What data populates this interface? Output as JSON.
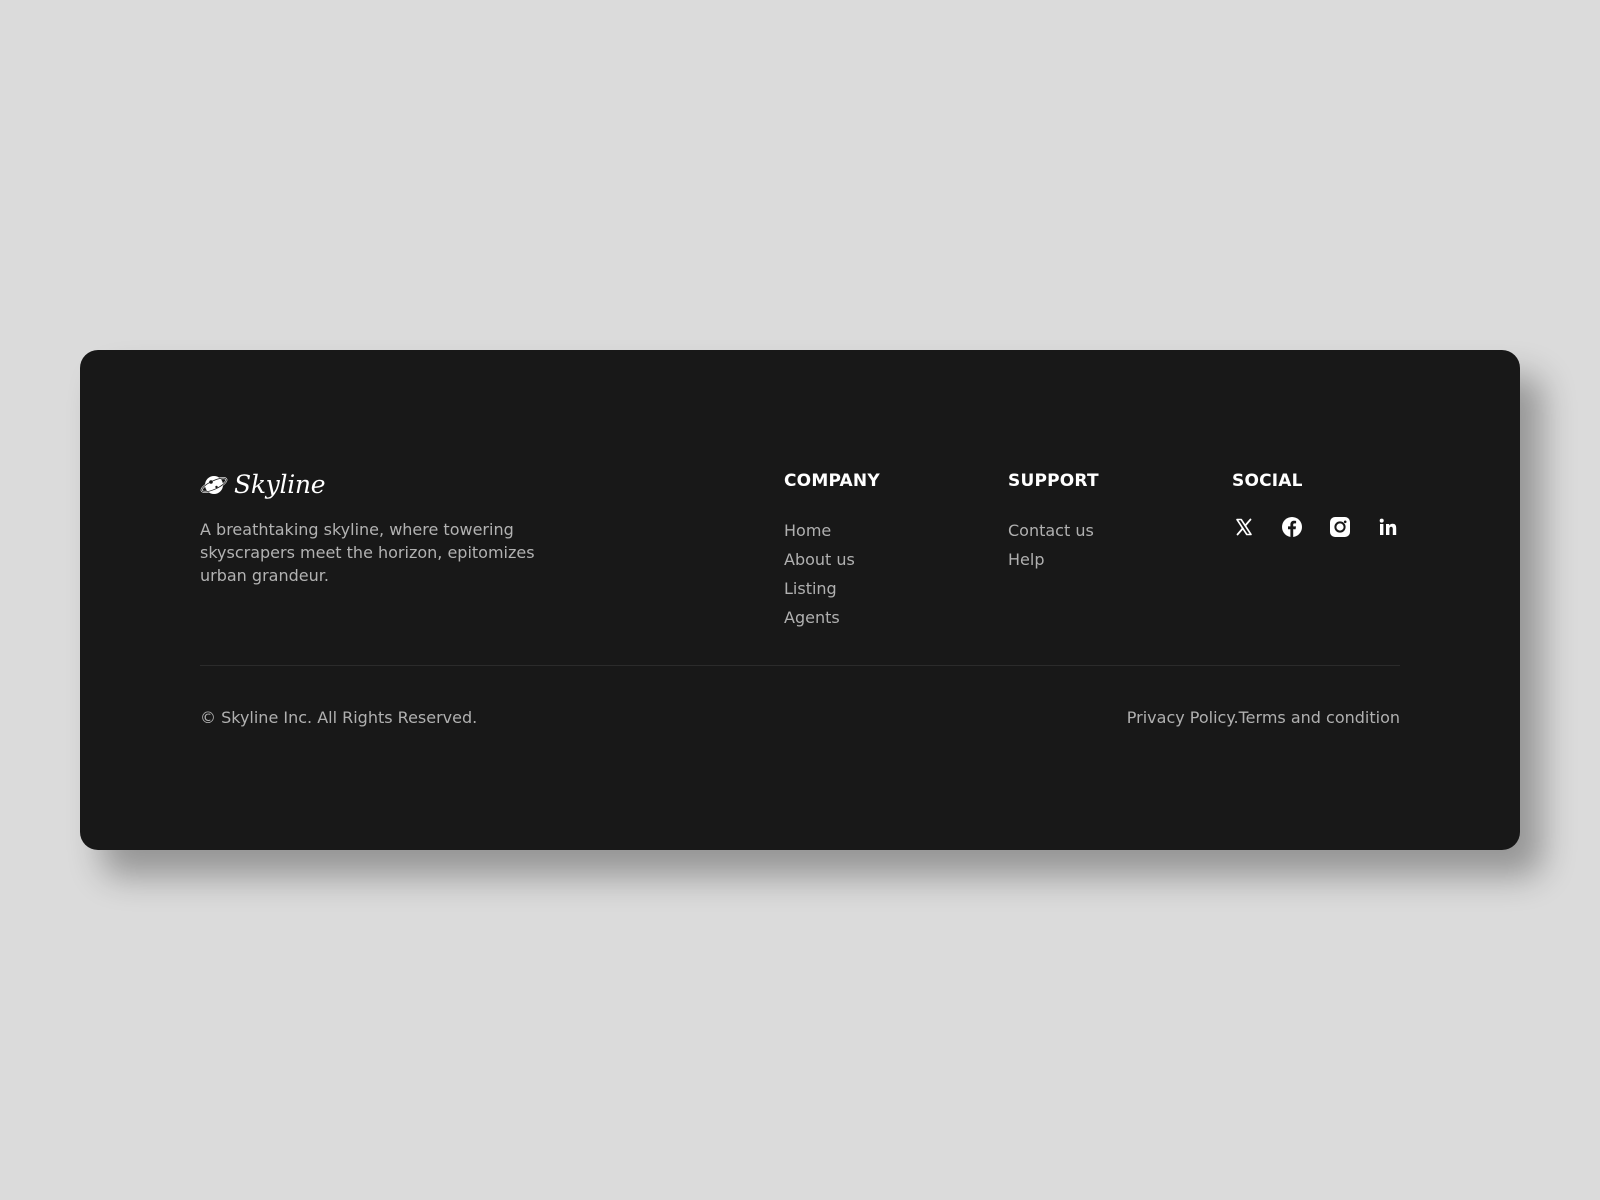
{
  "brand": {
    "name": "Skyline",
    "logo_icon": "planet-icon",
    "tagline": "A breathtaking skyline, where towering skyscrapers meet the horizon, epitomizes urban grandeur."
  },
  "columns": {
    "company": {
      "title": "COMPANY",
      "links": [
        "Home",
        "About us",
        "Listing",
        "Agents"
      ]
    },
    "support": {
      "title": "SUPPORT",
      "links": [
        "Contact us",
        "Help"
      ]
    },
    "social": {
      "title": "SOCIAL",
      "icons": [
        "x-icon",
        "facebook-icon",
        "instagram-icon",
        "linkedin-icon"
      ]
    }
  },
  "bottom": {
    "copyright": "© Skyline Inc. All Rights Reserved.",
    "privacy": "Privacy Policy.",
    "terms": "Terms and condition"
  },
  "colors": {
    "page_background": "#dbdbdb",
    "card_background": "#181818",
    "heading": "#ffffff",
    "muted_text": "#b0b0b0",
    "divider": "#2b2b2b"
  }
}
